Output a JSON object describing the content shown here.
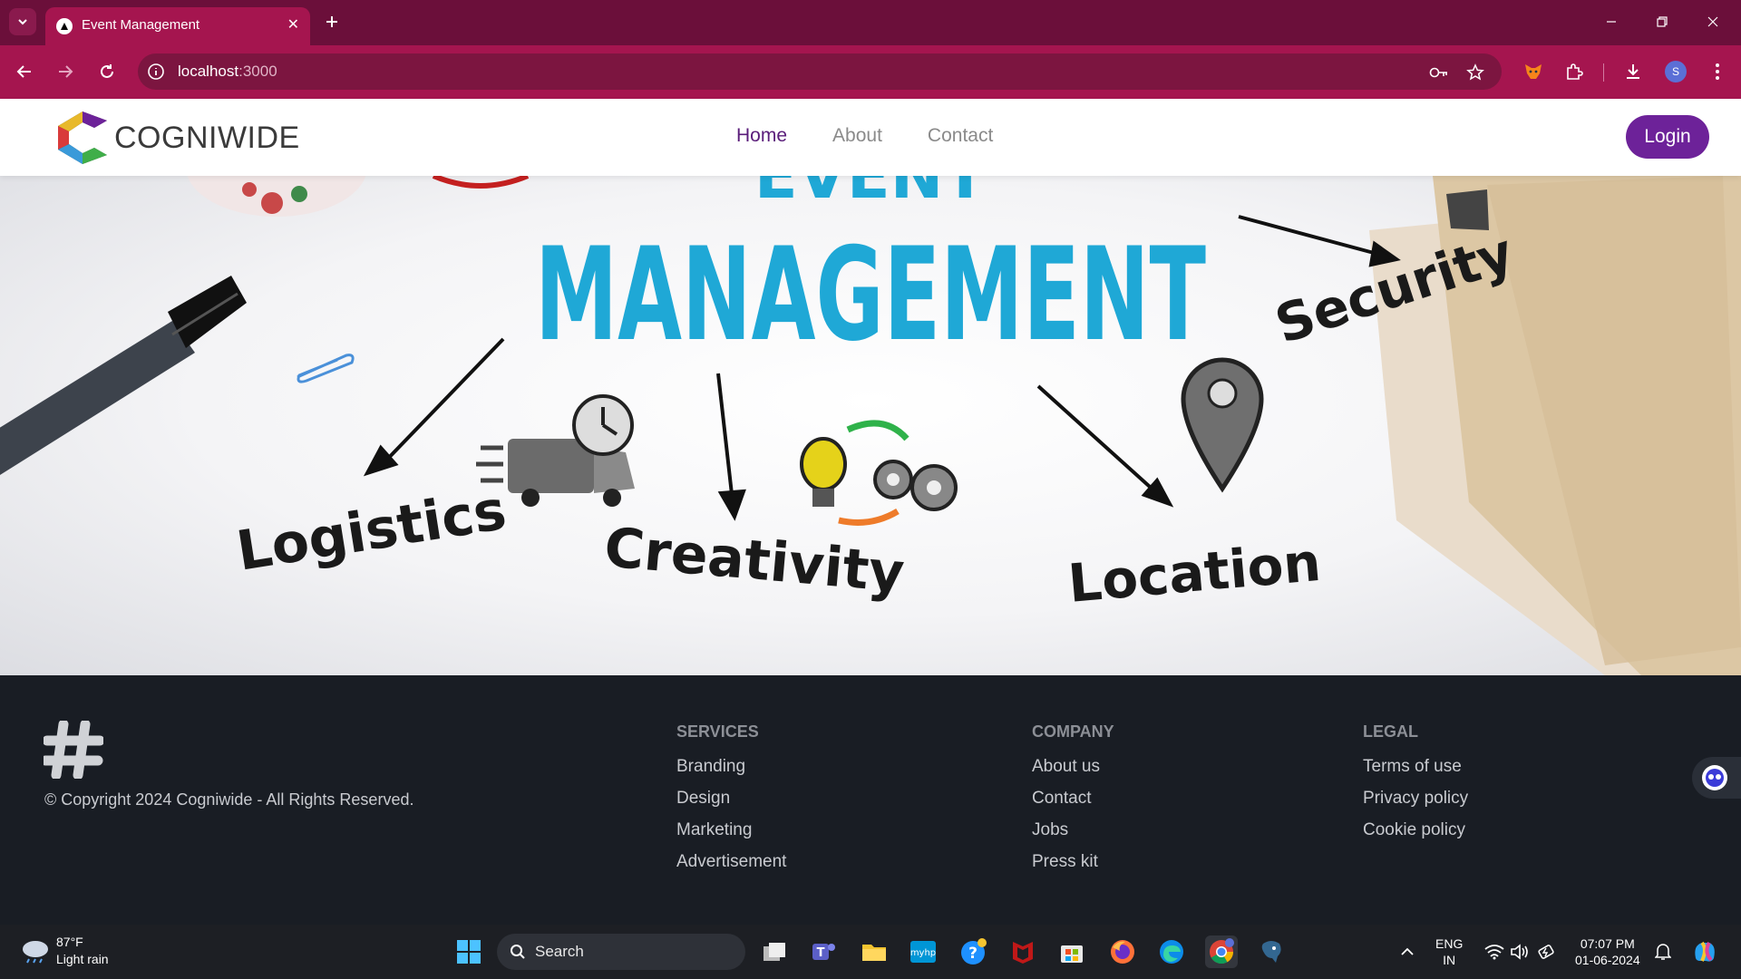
{
  "browser": {
    "tab_title": "Event Management",
    "url_host": "localhost",
    "url_port": ":3000"
  },
  "site": {
    "brand": "COGNIWIDE",
    "nav": [
      {
        "label": "Home",
        "active": true
      },
      {
        "label": "About",
        "active": false
      },
      {
        "label": "Contact",
        "active": false
      }
    ],
    "login_label": "Login"
  },
  "hero": {
    "heading_top": "EVENT",
    "heading_main": "MANAGEMENT",
    "labels": {
      "logistics": "Logistics",
      "creativity": "Creativity",
      "location": "Location",
      "security": "Security"
    },
    "heading_color": "#1fa8d6"
  },
  "footer": {
    "copyright": "© Copyright 2024 Cogniwide - All Rights Reserved.",
    "columns": [
      {
        "title": "SERVICES",
        "links": [
          "Branding",
          "Design",
          "Marketing",
          "Advertisement"
        ]
      },
      {
        "title": "COMPANY",
        "links": [
          "About us",
          "Contact",
          "Jobs",
          "Press kit"
        ]
      },
      {
        "title": "LEGAL",
        "links": [
          "Terms of use",
          "Privacy policy",
          "Cookie policy"
        ]
      }
    ]
  },
  "taskbar": {
    "weather_temp": "87°F",
    "weather_desc": "Light rain",
    "search_placeholder": "Search",
    "lang_top": "ENG",
    "lang_bottom": "IN",
    "time": "07:07 PM",
    "date": "01-06-2024"
  },
  "colors": {
    "chrome_tabbar": "#6b0f3a",
    "chrome_toolbar": "#a5154f",
    "brand_purple": "#6d2299",
    "footer_bg": "#191d24"
  }
}
